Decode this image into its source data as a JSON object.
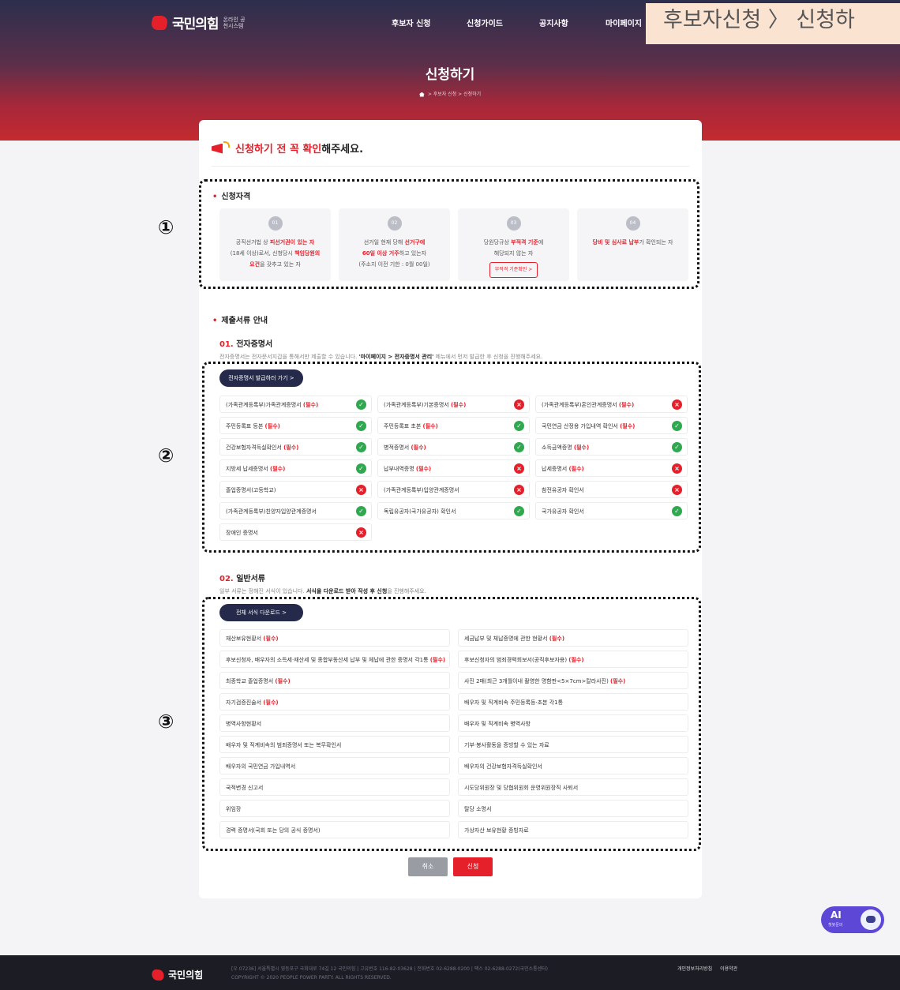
{
  "header": {
    "logo_text": "국민의힘",
    "logo_sub": "온라인 공천시스템",
    "nav": [
      "후보자 신청",
      "신청가이드",
      "공지사항",
      "마이페이지"
    ],
    "breadcrumb_overlay": "후보자신청 〉 신청하"
  },
  "hero": {
    "title": "신청하기",
    "breadcrumb": "> 후보자 신청 > 신청하기"
  },
  "notice": {
    "red": "신청하기 전 꼭 확인",
    "rest": "해주세요."
  },
  "markers": [
    "①",
    "②",
    "③"
  ],
  "qualification": {
    "title": "신청자격",
    "items": [
      {
        "num": "01",
        "l1_a": "공직선거법 상 ",
        "l1_b": "피선거권이 있는 자",
        "l2_a": "(18세 이상)로서, 신청당시 ",
        "l2_b": "책임당원의",
        "l3_b": "요건",
        "l3_a": "을 갖추고 있는 자"
      },
      {
        "num": "02",
        "l1_a": "선거일 현재 당해 ",
        "l1_b": "선거구에",
        "l2_b": "60일 이상 거주",
        "l2_a": "하고 있는자",
        "l3": "(주소지 이전 기한 : 0월 00일)"
      },
      {
        "num": "03",
        "l1_a": "당원당규상 ",
        "l1_b": "부적격 기준",
        "l1_c": "에",
        "l2": "해당되지 않는 자",
        "btn": "부적격 기준확인 >"
      },
      {
        "num": "04",
        "l1_b": "당비 및 심사료 납부",
        "l1_a": "가 확인되는 자"
      }
    ]
  },
  "documents": {
    "title": "제출서류 안내",
    "e_cert": {
      "num": "01.",
      "title": "전자증명서",
      "desc_a": "전자증명서는 전자문서지갑을 통해서만 제출할 수 있습니다. ",
      "desc_b": "'마이페이지 > 전자증명서 관리'",
      "desc_c": " 메뉴에서 먼저 발급한 후 신청을 진행해주세요.",
      "btn": "전자증명서 발급하러 가기 >",
      "req": "(필수)",
      "items": [
        {
          "label": "(가족관계등록부)가족관계증명서",
          "req": true,
          "ok": true
        },
        {
          "label": "(가족관계등록부)기본증명서",
          "req": true,
          "ok": false
        },
        {
          "label": "(가족관계등록부)혼인관계증명서",
          "req": true,
          "ok": false
        },
        {
          "label": "주민등록표 등본",
          "req": true,
          "ok": true
        },
        {
          "label": "주민등록표 초본",
          "req": true,
          "ok": true
        },
        {
          "label": "국민연금 산정용 가입내역 확인서",
          "req": true,
          "ok": true
        },
        {
          "label": "건강보험자격득실확인서",
          "req": true,
          "ok": true
        },
        {
          "label": "병적증명서",
          "req": true,
          "ok": true
        },
        {
          "label": "소득금액증명",
          "req": true,
          "ok": true
        },
        {
          "label": "지방세 납세증명서",
          "req": true,
          "ok": true
        },
        {
          "label": "납부내역증명",
          "req": true,
          "ok": false
        },
        {
          "label": "납세증명서",
          "req": true,
          "ok": false
        },
        {
          "label": "졸업증명서(고등학교)",
          "req": false,
          "ok": false
        },
        {
          "label": "(가족관계등록부)입양관계증명서",
          "req": false,
          "ok": false
        },
        {
          "label": "참전유공자 확인서",
          "req": false,
          "ok": false
        },
        {
          "label": "(가족관계등록부)친양자입양관계증명서",
          "req": false,
          "ok": true
        },
        {
          "label": "독립유공자(국가유공자) 확인서",
          "req": false,
          "ok": true
        },
        {
          "label": "국가유공자 확인서",
          "req": false,
          "ok": true
        },
        {
          "label": "장애인 증명서",
          "req": false,
          "ok": false
        }
      ]
    },
    "general": {
      "num": "02.",
      "title": "일반서류",
      "desc_a": "일부 서류는 정해진 서식이 있습니다. ",
      "desc_b": "서식을 다운로드 받아 작성 후 신청",
      "desc_c": "을 진행해주세요.",
      "btn": "전체 서식 다운로드 >",
      "req": "(필수)",
      "items": [
        {
          "label": "재산보유현황서",
          "req": true
        },
        {
          "label": "세금납부 및 체납증명에 관한 현황서",
          "req": true
        },
        {
          "label": "후보신청자, 배우자의 소득세·재산세 및 종합부동산세 납부 및 체납에 관한 증명서 각1통",
          "req": true
        },
        {
          "label": "후보신청자의 범죄경력회보서(공직후보자용)",
          "req": true
        },
        {
          "label": "최종학교 졸업증명서",
          "req": true
        },
        {
          "label": "사진 2매(최근 3개월이내 촬영한 명함판<5×7cm>칼라사진)",
          "req": true
        },
        {
          "label": "자기검증진술서",
          "req": true
        },
        {
          "label": "배우자 및 직계비속 주민등록등·초본 각1통",
          "req": false
        },
        {
          "label": "병역사항현황서",
          "req": false
        },
        {
          "label": "배우자 및 직계비속 병역사항",
          "req": false
        },
        {
          "label": "배우자 및 직계비속의 범죄증명서 또는 복무확인서",
          "req": false
        },
        {
          "label": "기부·봉사활동을 증빙할 수 있는 자료",
          "req": false
        },
        {
          "label": "배우자의 국민연금 가입내역서",
          "req": false
        },
        {
          "label": "배우자의 건강보험자격득실확인서",
          "req": false
        },
        {
          "label": "국적변경 신고서",
          "req": false
        },
        {
          "label": "시도당위원장 및 당협위원회 운영위원장직 사퇴서",
          "req": false
        },
        {
          "label": "위임장",
          "req": false
        },
        {
          "label": "탈당 소명서",
          "req": false
        },
        {
          "label": "경력 증명서(국회 또는 당의 공식 증명서)",
          "req": false
        },
        {
          "label": "가상자산 보유현황 증빙자료",
          "req": false
        }
      ]
    }
  },
  "actions": {
    "cancel": "취소",
    "submit": "신청"
  },
  "ai_badge": {
    "label": "AI",
    "sub": "챗봇문의"
  },
  "footer": {
    "logo": "국민의힘",
    "address": "[우 07236] 서울특별시 영등포구 국회대로 74길 12 국민의힘 | 고유번호 116-82-03628 | 전화번호 02-6288-0200 | 팩스 02-6288-0272(국민소통센터)",
    "copyright": "COPYRIGHT © 2020 PEOPLE POWER PARTY. ALL RIGHTS RESERVED.",
    "links": [
      "개인정보처리방침",
      "이용약관"
    ]
  },
  "colors": {
    "accent": "#e6202a",
    "navy": "#262a4a",
    "ok": "#2fa84f"
  }
}
